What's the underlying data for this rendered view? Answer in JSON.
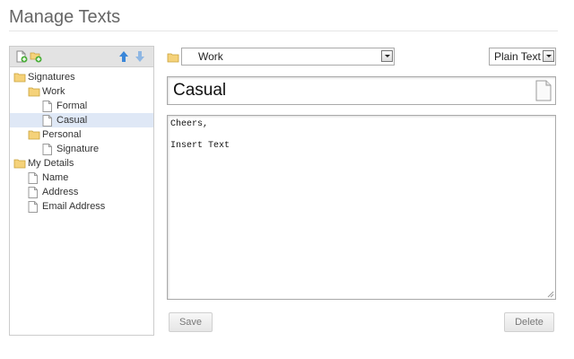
{
  "page": {
    "title": "Manage Texts"
  },
  "tree": {
    "toolbar": {
      "new_text_icon": "new-document-icon",
      "new_folder_icon": "new-folder-icon",
      "move_up_icon": "arrow-up-icon",
      "move_down_icon": "arrow-down-icon"
    },
    "items": [
      {
        "label": "Signatures",
        "type": "folder",
        "level": 0
      },
      {
        "label": "Work",
        "type": "folder",
        "level": 1
      },
      {
        "label": "Formal",
        "type": "text",
        "level": 2
      },
      {
        "label": "Casual",
        "type": "text",
        "level": 2,
        "selected": true
      },
      {
        "label": "Personal",
        "type": "folder",
        "level": 1
      },
      {
        "label": "Signature",
        "type": "text",
        "level": 2
      },
      {
        "label": "My Details",
        "type": "folder",
        "level": 0
      },
      {
        "label": "Name",
        "type": "text",
        "level": 1
      },
      {
        "label": "Address",
        "type": "text",
        "level": 1
      },
      {
        "label": "Email Address",
        "type": "text",
        "level": 1
      }
    ]
  },
  "editor": {
    "folder_value": "Work",
    "format_value": "Plain Text",
    "name_value": "Casual",
    "body_lines": [
      "Cheers,",
      "",
      "Insert Text"
    ],
    "save_label": "Save",
    "delete_label": "Delete"
  },
  "colors": {
    "selected_row": "#dfe8f6",
    "folder": "#f5d27a",
    "arrow_blue": "#3a86d8"
  }
}
